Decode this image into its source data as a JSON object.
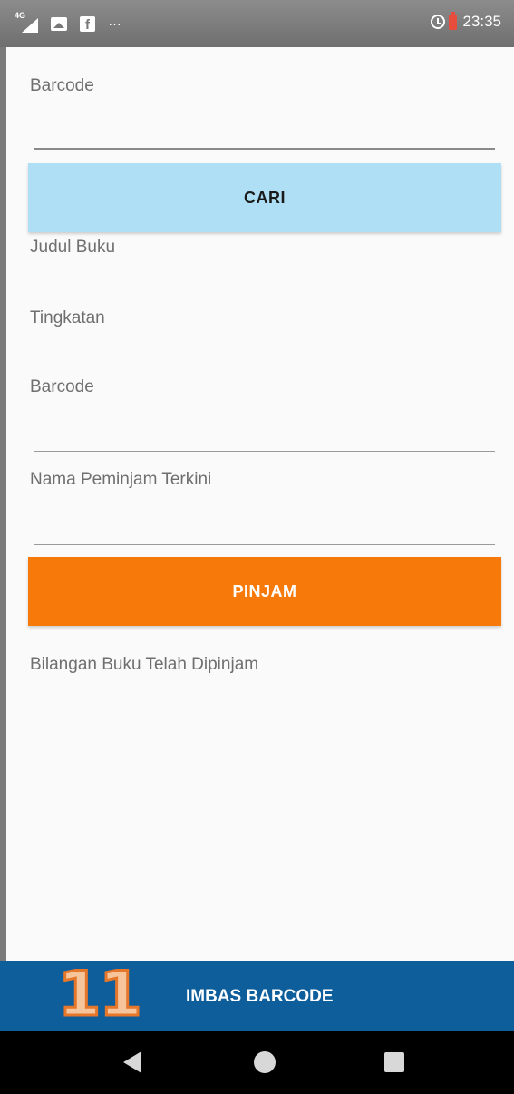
{
  "status_bar": {
    "network_label": "4G",
    "time": "23:35",
    "icons": [
      "signal-icon",
      "image-icon",
      "facebook-icon",
      "more-icon",
      "alarm-icon",
      "battery-icon"
    ]
  },
  "form": {
    "barcode_input": {
      "label": "Barcode",
      "value": ""
    },
    "search_button": "CARI",
    "book_title_label": "Judul Buku",
    "level_label": "Tingkatan",
    "barcode_label_2": "Barcode",
    "borrower_label": "Nama Peminjam Terkini",
    "borrow_button": "PINJAM",
    "borrowed_count_label": "Bilangan Buku Telah Dipinjam"
  },
  "scan_bar": {
    "count": "11",
    "label": "IMBAS BARCODE"
  },
  "colors": {
    "search_button_bg": "#aedff4",
    "borrow_button_bg": "#f7790a",
    "scan_bar_bg": "#0e5e9b",
    "status_bar_bg": "#7d7d7d",
    "nav_bar_bg": "#000000"
  },
  "nav_bar": {
    "icons": [
      "back-icon",
      "home-icon",
      "recent-apps-icon"
    ]
  }
}
